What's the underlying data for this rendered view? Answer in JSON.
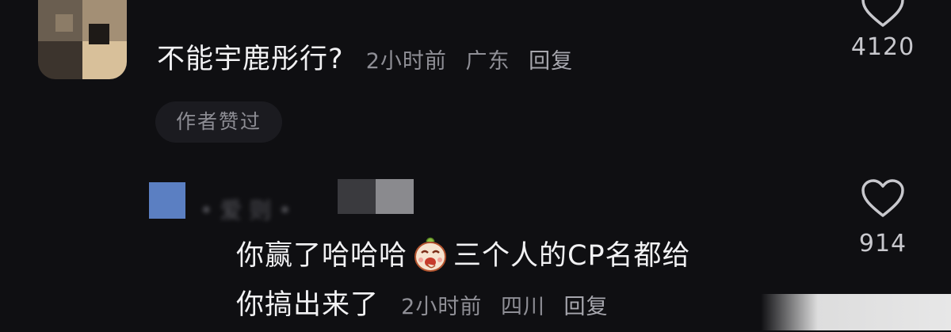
{
  "comment": {
    "text": "不能宇鹿彤行?",
    "time": "2小时前",
    "location": "广东",
    "reply_label": "回复",
    "like_count": "4120",
    "badge": "作者赞过"
  },
  "reply": {
    "text_line1_part1": "你赢了哈哈哈",
    "text_line1_part2": "三个人的CP名都给",
    "text_line2": "你搞出来了",
    "time": "2小时前",
    "location": "四川",
    "reply_label": "回复",
    "like_count": "914",
    "emoji": "laughing-egg-emoji"
  },
  "icons": {
    "like": "heart-outline-icon"
  },
  "colors": {
    "background": "#0f0f12",
    "text_primary": "#f1f1f3",
    "text_meta": "#8f8f96",
    "badge_bg": "#1b1b20"
  }
}
